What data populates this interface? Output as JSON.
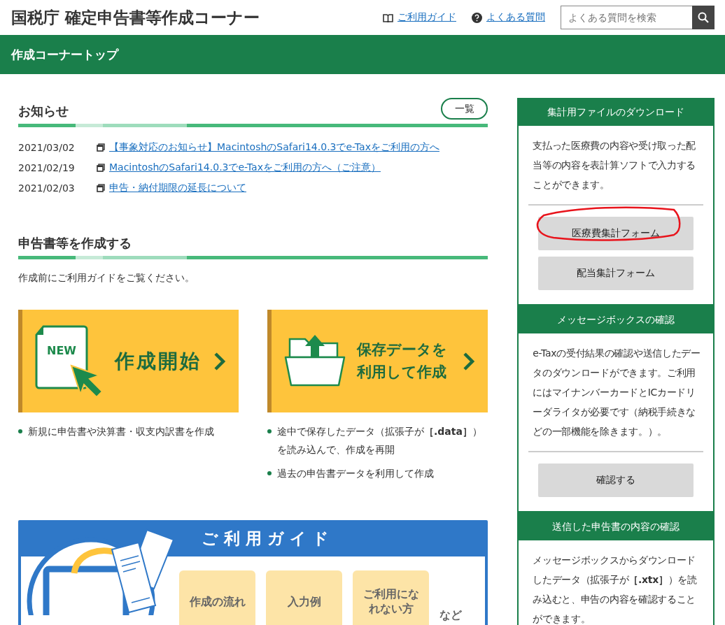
{
  "header": {
    "title": "国税庁 確定申告書等作成コーナー",
    "links": [
      {
        "label": "ご利用ガイド",
        "kind": "book"
      },
      {
        "label": "よくある質問",
        "kind": "help"
      }
    ],
    "search": {
      "placeholder": "よくある質問を検索"
    }
  },
  "nav": {
    "title": "作成コーナートップ"
  },
  "news": {
    "title": "お知らせ",
    "list_button": "一覧",
    "items": [
      {
        "date": "2021/03/02",
        "title": "【事象対応のお知らせ】MacintoshのSafari14.0.3でe-Taxをご利用の方へ"
      },
      {
        "date": "2021/02/19",
        "title": "MacintoshのSafari14.0.3でe-Taxをご利用の方へ（ご注意）"
      },
      {
        "date": "2021/02/03",
        "title": "申告・納付期限の延長について"
      }
    ]
  },
  "create": {
    "title": "申告書等を作成する",
    "note": "作成前にご利用ガイドをご覧ください。",
    "cards": [
      {
        "kind": "new",
        "badge": "NEW",
        "label": "作成開始",
        "notes": [
          "新規に申告書や決算書・収支内訳書を作成"
        ]
      },
      {
        "kind": "saved",
        "label": "保存データを利用して作成",
        "notes": [
          "途中で保存したデータ（拡張子が**［.data］**）を読み込んで、作成を再開",
          "過去の申告書データを利用して作成"
        ]
      }
    ]
  },
  "guide": {
    "title": "ご利用ガイド",
    "items": [
      "作成の流れ",
      "入力例",
      "ご利用になれない方"
    ],
    "suffix": "など"
  },
  "sidebar": [
    {
      "title": "集計用ファイルのダウンロード",
      "text": "支払った医療費の内容や受け取った配当等の内容を表計算ソフトで入力することができます。",
      "buttons": [
        {
          "label": "医療費集計フォーム",
          "circled": true
        },
        {
          "label": "配当集計フォーム",
          "circled": false
        }
      ]
    },
    {
      "title": "メッセージボックスの確認",
      "text": "e-Taxの受付結果の確認や送信したデータのダウンロードができます。ご利用にはマイナンバーカードとICカードリーダライタが必要です（納税手続きなどの一部機能を除きます。）。",
      "buttons": [
        {
          "label": "確認する",
          "circled": false
        }
      ]
    },
    {
      "title": "送信した申告書の内容の確認",
      "text": "メッセージボックスからダウンロードしたデータ（拡張子が**［.xtx］**）を読み込むと、申告の内容を確認することができます。"
    }
  ]
}
